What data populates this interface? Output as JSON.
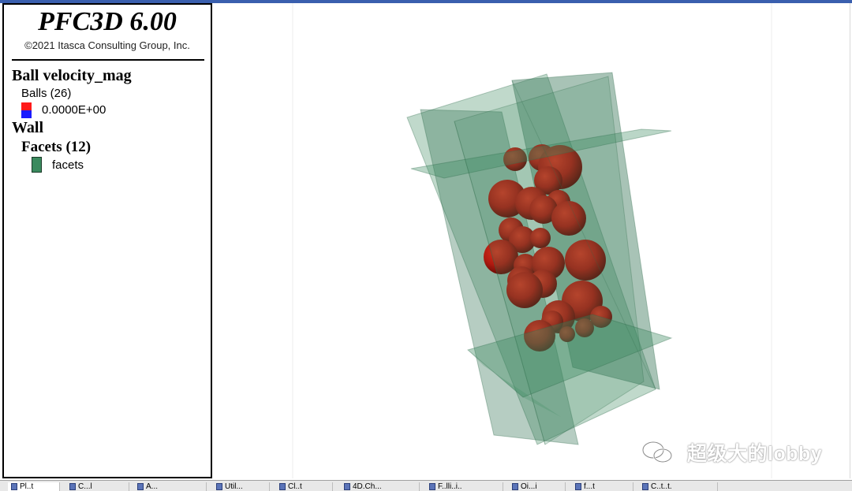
{
  "legend": {
    "app_title": "PFC3D 6.00",
    "copyright": "©2021 Itasca Consulting Group, Inc.",
    "ball_heading": "Ball velocity_mag",
    "balls_label": "Balls (26)",
    "velocity_value": "0.0000E+00",
    "wall_heading": "Wall",
    "facets_heading": "Facets (12)",
    "facets_label": "facets"
  },
  "colors": {
    "ball": "#b01a10",
    "facet": "#3a8a5e",
    "swatch_high": "#ff1a1a",
    "swatch_low": "#1a1aff"
  },
  "watermark": {
    "text": "超级大的lobby",
    "icon": "wechat-icon"
  },
  "tabs": [
    {
      "label": "Pl..t",
      "icon": "document-icon",
      "active": true
    },
    {
      "label": "C...l",
      "icon": "document-icon"
    },
    {
      "label": "A...",
      "icon": "document-icon"
    },
    {
      "label": "Util...",
      "icon": "document-icon"
    },
    {
      "label": "Cl..t",
      "icon": "document-icon"
    },
    {
      "label": "4D.Ch...",
      "icon": "document-icon"
    },
    {
      "label": "F..lli..i..",
      "icon": "document-icon"
    },
    {
      "label": "Oi...i",
      "icon": "document-icon"
    },
    {
      "label": "f...t",
      "icon": "document-icon"
    },
    {
      "label": "C..t..t.",
      "icon": "document-icon"
    }
  ]
}
